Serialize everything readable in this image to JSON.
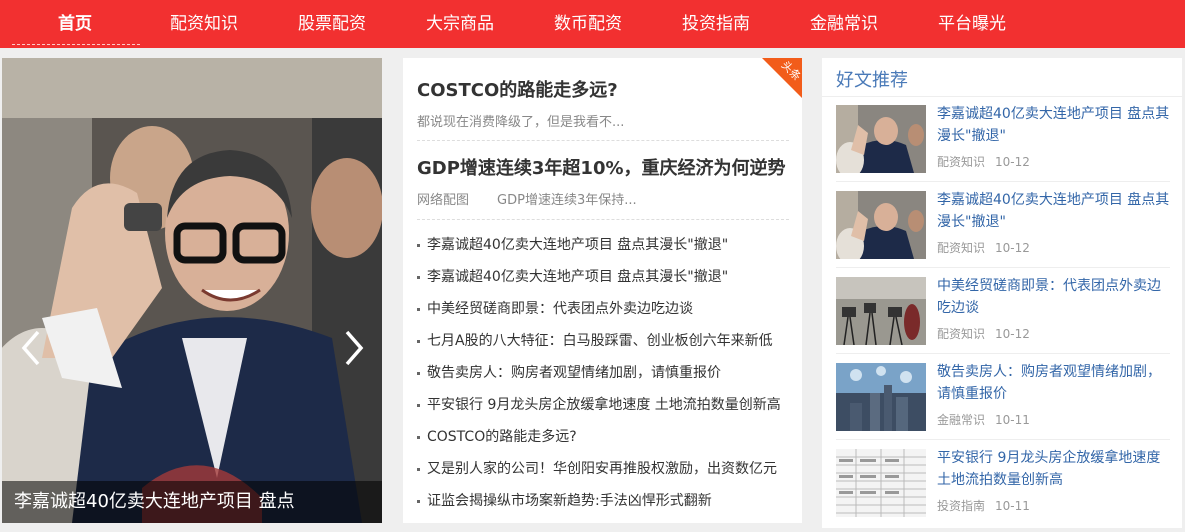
{
  "nav": {
    "items": [
      "首页",
      "配资知识",
      "股票配资",
      "大宗商品",
      "数币配资",
      "投资指南",
      "金融常识",
      "平台曝光"
    ],
    "active_index": 0
  },
  "slider": {
    "caption": "李嘉诚超40亿卖大连地产项目 盘点"
  },
  "news": {
    "ribbon": "头条",
    "headlines": [
      {
        "title": "COSTCO的路能走多远?",
        "summary": "都说现在消费降级了，但是我看不..."
      },
      {
        "title": "GDP增速连续3年超10%，重庆经济为何逆势",
        "category": "网络配图",
        "summary": "GDP增速连续3年保持..."
      }
    ],
    "list": [
      "李嘉诚超40亿卖大连地产项目 盘点其漫长\"撤退\"",
      "李嘉诚超40亿卖大连地产项目 盘点其漫长\"撤退\"",
      "中美经贸磋商即景：代表团点外卖边吃边谈",
      "七月A股的八大特征：白马股踩雷、创业板创六年来新低",
      "敬告卖房人：购房者观望情绪加剧，请慎重报价",
      "平安银行 9月龙头房企放缓拿地速度 土地流拍数量创新高",
      "COSTCO的路能走多远?",
      "又是别人家的公司！华创阳安再推股权激励，出资数亿元",
      "证监会揭操纵市场案新趋势:手法凶悍形式翻新"
    ]
  },
  "recommend": {
    "title": "好文推荐",
    "items": [
      {
        "title": "李嘉诚超40亿卖大连地产项目 盘点其漫长\"撤退\"",
        "category": "配资知识",
        "date": "10-12",
        "thumb": "people"
      },
      {
        "title": "李嘉诚超40亿卖大连地产项目 盘点其漫长\"撤退\"",
        "category": "配资知识",
        "date": "10-12",
        "thumb": "people"
      },
      {
        "title": "中美经贸磋商即景：代表团点外卖边吃边谈",
        "category": "配资知识",
        "date": "10-12",
        "thumb": "press"
      },
      {
        "title": "敬告卖房人：购房者观望情绪加剧，请慎重报价",
        "category": "金融常识",
        "date": "10-11",
        "thumb": "city"
      },
      {
        "title": "平安银行 9月龙头房企放缓拿地速度 土地流拍数量创新高",
        "category": "投资指南",
        "date": "10-11",
        "thumb": "table"
      }
    ]
  },
  "colors": {
    "nav_bg": "#f23030",
    "ribbon": "#f25c1a",
    "link_blue": "#3366a8",
    "title_blue": "#4a7ab8"
  }
}
